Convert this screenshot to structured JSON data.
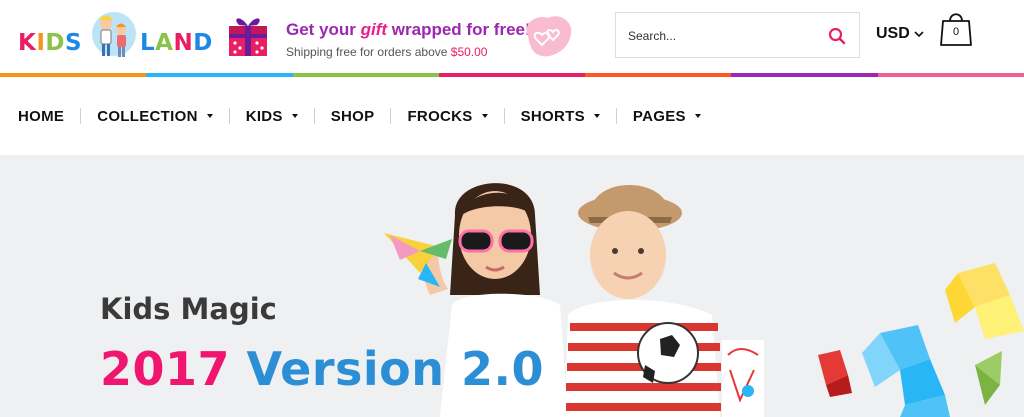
{
  "logo": {
    "kids": "KIDS",
    "land": "LAND",
    "colors": {
      "kids": "#e91e63",
      "land": "#1e88e5",
      "accent": "#8bc34a"
    }
  },
  "promo": {
    "title_before": "Get your ",
    "title_highlight": "gift",
    "title_after": " wrapped for free!",
    "subtitle_before": "Shipping free for orders above ",
    "subtitle_amount": "$50.00",
    "icons": [
      "gift-icon",
      "hearts-icon"
    ]
  },
  "search": {
    "placeholder": "Search...",
    "icon": "search-icon",
    "accent": "#e91e63"
  },
  "currency": {
    "label": "USD",
    "icon": "chevron-down-icon"
  },
  "cart": {
    "count": "0",
    "icon": "shopping-bag-icon"
  },
  "rainbow": [
    "#f7941d",
    "#29b6f6",
    "#8bc34a",
    "#e91e63",
    "#ff5722",
    "#9c27b0",
    "#f06292"
  ],
  "nav": {
    "items": [
      {
        "label": "HOME",
        "dropdown": false
      },
      {
        "label": "COLLECTION",
        "dropdown": true
      },
      {
        "label": "KIDS",
        "dropdown": true
      },
      {
        "label": "SHOP",
        "dropdown": false
      },
      {
        "label": "FROCKS",
        "dropdown": true
      },
      {
        "label": "SHORTS",
        "dropdown": true
      },
      {
        "label": "PAGES",
        "dropdown": true
      }
    ]
  },
  "hero": {
    "kicker": "Kids Magic",
    "year": "2017",
    "version": "Version 2.0",
    "colors": {
      "year": "#f0166f",
      "version": "#2c8fd6"
    }
  }
}
